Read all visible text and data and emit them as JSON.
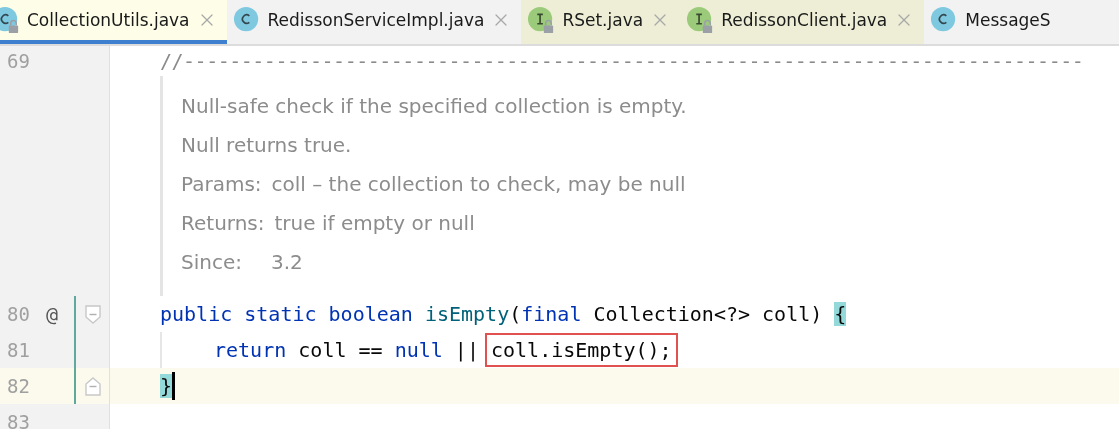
{
  "tabs": [
    {
      "label": "CollectionUtils.java",
      "kind": "class",
      "locked": true,
      "selected": true,
      "library": false,
      "closable": true
    },
    {
      "label": "RedissonServiceImpl.java",
      "kind": "class",
      "locked": false,
      "selected": false,
      "library": false,
      "closable": true
    },
    {
      "label": "RSet.java",
      "kind": "interface",
      "locked": true,
      "selected": false,
      "library": true,
      "closable": true
    },
    {
      "label": "RedissonClient.java",
      "kind": "interface",
      "locked": true,
      "selected": false,
      "library": true,
      "closable": true
    },
    {
      "label": "MessageS",
      "kind": "class",
      "locked": false,
      "selected": false,
      "library": false,
      "closable": false
    }
  ],
  "editor": {
    "rows": [
      {
        "kind": "separator",
        "number": "69",
        "text": "//------------------------------------------------------------------------------"
      },
      {
        "kind": "doc",
        "paragraphs": [
          "Null-safe check if the specified collection is empty.",
          "Null returns true."
        ],
        "tags": [
          {
            "label": "Params:",
            "text": "coll – the collection to check, may be null"
          },
          {
            "label": "Returns:",
            "text": "true if empty or null"
          },
          {
            "label": "Since:",
            "text": "3.2"
          }
        ]
      },
      {
        "kind": "code",
        "number": "80",
        "annotation": "@",
        "fold_start": true,
        "fold_end": false,
        "changed": true,
        "current": false,
        "caret": false,
        "tokens": [
          {
            "text": "public static boolean ",
            "kind": "keyword"
          },
          {
            "text": "isEmpty",
            "kind": "method"
          },
          {
            "text": "(",
            "kind": "plain"
          },
          {
            "text": "final ",
            "kind": "keyword"
          },
          {
            "text": "Collection<?> coll) ",
            "kind": "plain"
          },
          {
            "text": "{",
            "kind": "plain",
            "match": true
          }
        ]
      },
      {
        "kind": "code",
        "number": "81",
        "fold_start": false,
        "fold_end": false,
        "changed": true,
        "current": false,
        "caret": false,
        "indent": true,
        "tokens": [
          {
            "text": "return ",
            "kind": "keyword"
          },
          {
            "text": "coll == ",
            "kind": "plain"
          },
          {
            "text": "null ",
            "kind": "keyword"
          },
          {
            "text": "|| ",
            "kind": "plain"
          },
          {
            "text": "coll.isEmpty();",
            "kind": "plain",
            "boxed": true
          }
        ]
      },
      {
        "kind": "code",
        "number": "82",
        "fold_start": false,
        "fold_end": true,
        "changed": true,
        "current": true,
        "caret": true,
        "tokens": [
          {
            "text": "}",
            "kind": "plain",
            "match": true
          }
        ]
      },
      {
        "kind": "code",
        "number": "83",
        "fold_start": false,
        "fold_end": false,
        "changed": false,
        "current": false,
        "caret": false,
        "tokens": []
      }
    ]
  }
}
